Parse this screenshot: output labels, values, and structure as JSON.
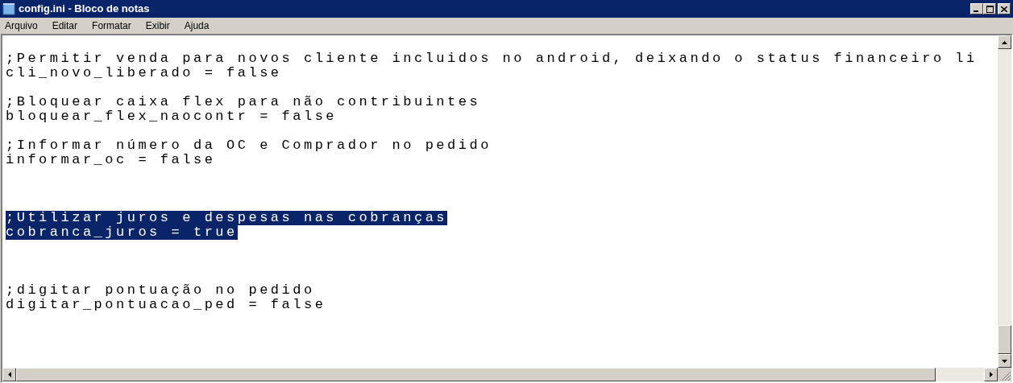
{
  "window": {
    "title": "config.ini - Bloco de notas"
  },
  "menu": [
    "Arquivo",
    "Editar",
    "Formatar",
    "Exibir",
    "Ajuda"
  ],
  "editor": {
    "lines": [
      {
        "kind": "blank"
      },
      {
        "kind": "text",
        "text": ";Permitir venda para novos cliente incluidos no android, deixando o status financeiro li",
        "selected": false
      },
      {
        "kind": "text",
        "text": "cli_novo_liberado = false",
        "selected": false
      },
      {
        "kind": "blank"
      },
      {
        "kind": "text",
        "text": ";Bloquear caixa flex para não contribuintes",
        "selected": false
      },
      {
        "kind": "text",
        "text": "bloquear_flex_naocontr = false",
        "selected": false
      },
      {
        "kind": "blank"
      },
      {
        "kind": "text",
        "text": ";Informar número da OC e Comprador no pedido",
        "selected": false
      },
      {
        "kind": "text",
        "text": "informar_oc = false",
        "selected": false
      },
      {
        "kind": "blank"
      },
      {
        "kind": "blank"
      },
      {
        "kind": "blank"
      },
      {
        "kind": "text",
        "text": ";Utilizar juros e despesas nas cobranças",
        "selected": true
      },
      {
        "kind": "text",
        "text": "cobranca_juros = true",
        "selected": true
      },
      {
        "kind": "blank"
      },
      {
        "kind": "blank"
      },
      {
        "kind": "blank"
      },
      {
        "kind": "text",
        "text": ";digitar pontuação no pedido",
        "selected": false
      },
      {
        "kind": "text",
        "text": "digitar_pontuacao_ped = false",
        "selected": false
      }
    ]
  }
}
